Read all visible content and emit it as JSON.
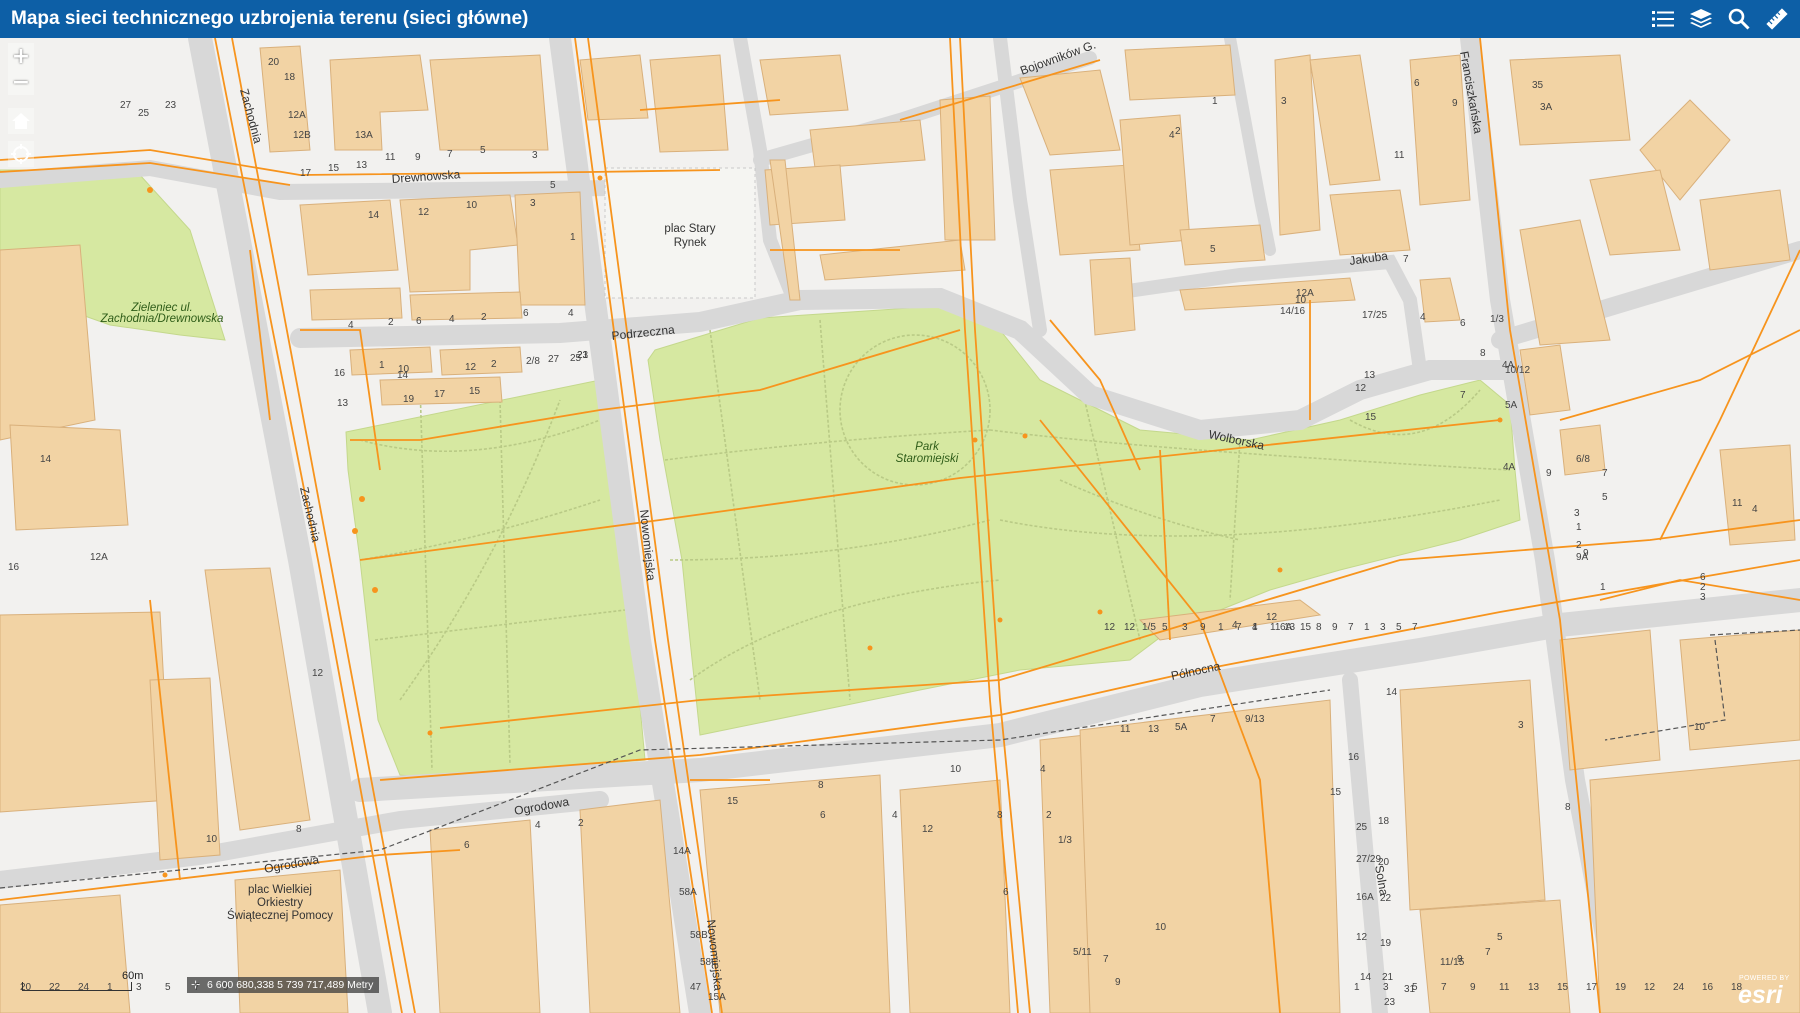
{
  "header": {
    "title": "Mapa sieci technicznego uzbrojenia terenu (sieci główne)",
    "tools": [
      "list-icon",
      "layers-icon",
      "search-icon",
      "ruler-icon"
    ]
  },
  "controls": {
    "zoom_in": "+",
    "zoom_out": "−",
    "home": "home-icon",
    "locate": "locate-icon"
  },
  "scalebar": {
    "label": "60m"
  },
  "coordinates": {
    "text": "6 600 680,338 5 739 717,489 Metry"
  },
  "attribution": {
    "powered": "POWERED BY",
    "brand": "esri"
  },
  "colors": {
    "header": "#0d5fa6",
    "background": "#f2f1ef",
    "building": "#f2d3a4",
    "building_outline": "#d9b07b",
    "park": "#d6e8a1",
    "road": "#dedede",
    "network": "#f7941d"
  },
  "map": {
    "streets": {
      "drewnowska": "Drewnowska",
      "zachodnia_top": "Zachodnia",
      "zachodnia_mid": "Zachodnia",
      "podrzeczna": "Podrzeczna",
      "nowomiejska": "Nowomiejska",
      "nowomiejska_bottom": "Nowomiejska",
      "wolborska": "Wolborska",
      "jakuba": "Jakuba",
      "franciszkanska": "Franciszkańska",
      "bojownikow": "Bojowników G.",
      "polnocna": "Północna",
      "ogrodowa_1": "Ogrodowa",
      "ogrodowa_2": "Ogrodowa",
      "solna": "Solna"
    },
    "places": {
      "plac_stary_rynek_1": "plac Stary",
      "plac_stary_rynek_2": "Rynek",
      "park_1": "Park",
      "park_2": "Staromiejski",
      "zielen_1": "Zieleniec ul.",
      "zielen_2": "Zachodnia/Drewnowska",
      "plac_wosp_1": "plac Wielkiej",
      "plac_wosp_2": "Orkiestry",
      "plac_wosp_3": "Świątecznej Pomocy"
    },
    "house_numbers": [
      "23",
      "27",
      "25",
      "20",
      "18",
      "12A",
      "12B",
      "13A",
      "11",
      "9",
      "7",
      "5",
      "3",
      "17",
      "15",
      "13",
      "14",
      "12",
      "10",
      "3",
      "5",
      "1",
      "4",
      "2",
      "6",
      "4",
      "2",
      "6",
      "4",
      "1",
      "16",
      "14",
      "10",
      "12",
      "2",
      "2/8",
      "27",
      "25",
      "23",
      "21",
      "19",
      "17",
      "15",
      "13",
      "14",
      "12A",
      "16",
      "12",
      "10",
      "8",
      "6",
      "4",
      "2",
      "14A",
      "58A",
      "58B",
      "58C",
      "47",
      "15A",
      "15",
      "8",
      "6",
      "4",
      "12",
      "10",
      "8",
      "6",
      "4",
      "2",
      "1/3",
      "5/11",
      "7",
      "9",
      "11",
      "13",
      "5A",
      "7",
      "9/13",
      "10",
      "12",
      "15",
      "14",
      "16",
      "18",
      "20",
      "22",
      "19",
      "21",
      "23",
      "25",
      "27/29",
      "16A",
      "12",
      "14",
      "31",
      "11/15",
      "9",
      "7",
      "5",
      "3",
      "10",
      "8",
      "6",
      "4",
      "2",
      "1",
      "3",
      "5",
      "7",
      "9",
      "11",
      "3A",
      "35",
      "1/3",
      "4A",
      "5A",
      "7",
      "8",
      "6",
      "4",
      "14/16",
      "12A",
      "10",
      "12",
      "13",
      "15",
      "17/25",
      "10/12",
      "4A",
      "6/8",
      "4",
      "11",
      "9",
      "7",
      "5",
      "3",
      "1",
      "2",
      "9A",
      "9",
      "1",
      "3",
      "2",
      "6",
      "6A",
      "4",
      "7",
      "1",
      "9",
      "3",
      "5",
      "1/5",
      "12",
      "12",
      "4",
      "1",
      "11",
      "13",
      "15",
      "8",
      "9",
      "7",
      "1",
      "3",
      "5",
      "7",
      "1",
      "3",
      "5",
      "7",
      "9",
      "11",
      "13",
      "15",
      "17",
      "19",
      "12",
      "24",
      "16",
      "18",
      "20",
      "22",
      "24",
      "1",
      "3",
      "5",
      "7",
      "9"
    ]
  }
}
